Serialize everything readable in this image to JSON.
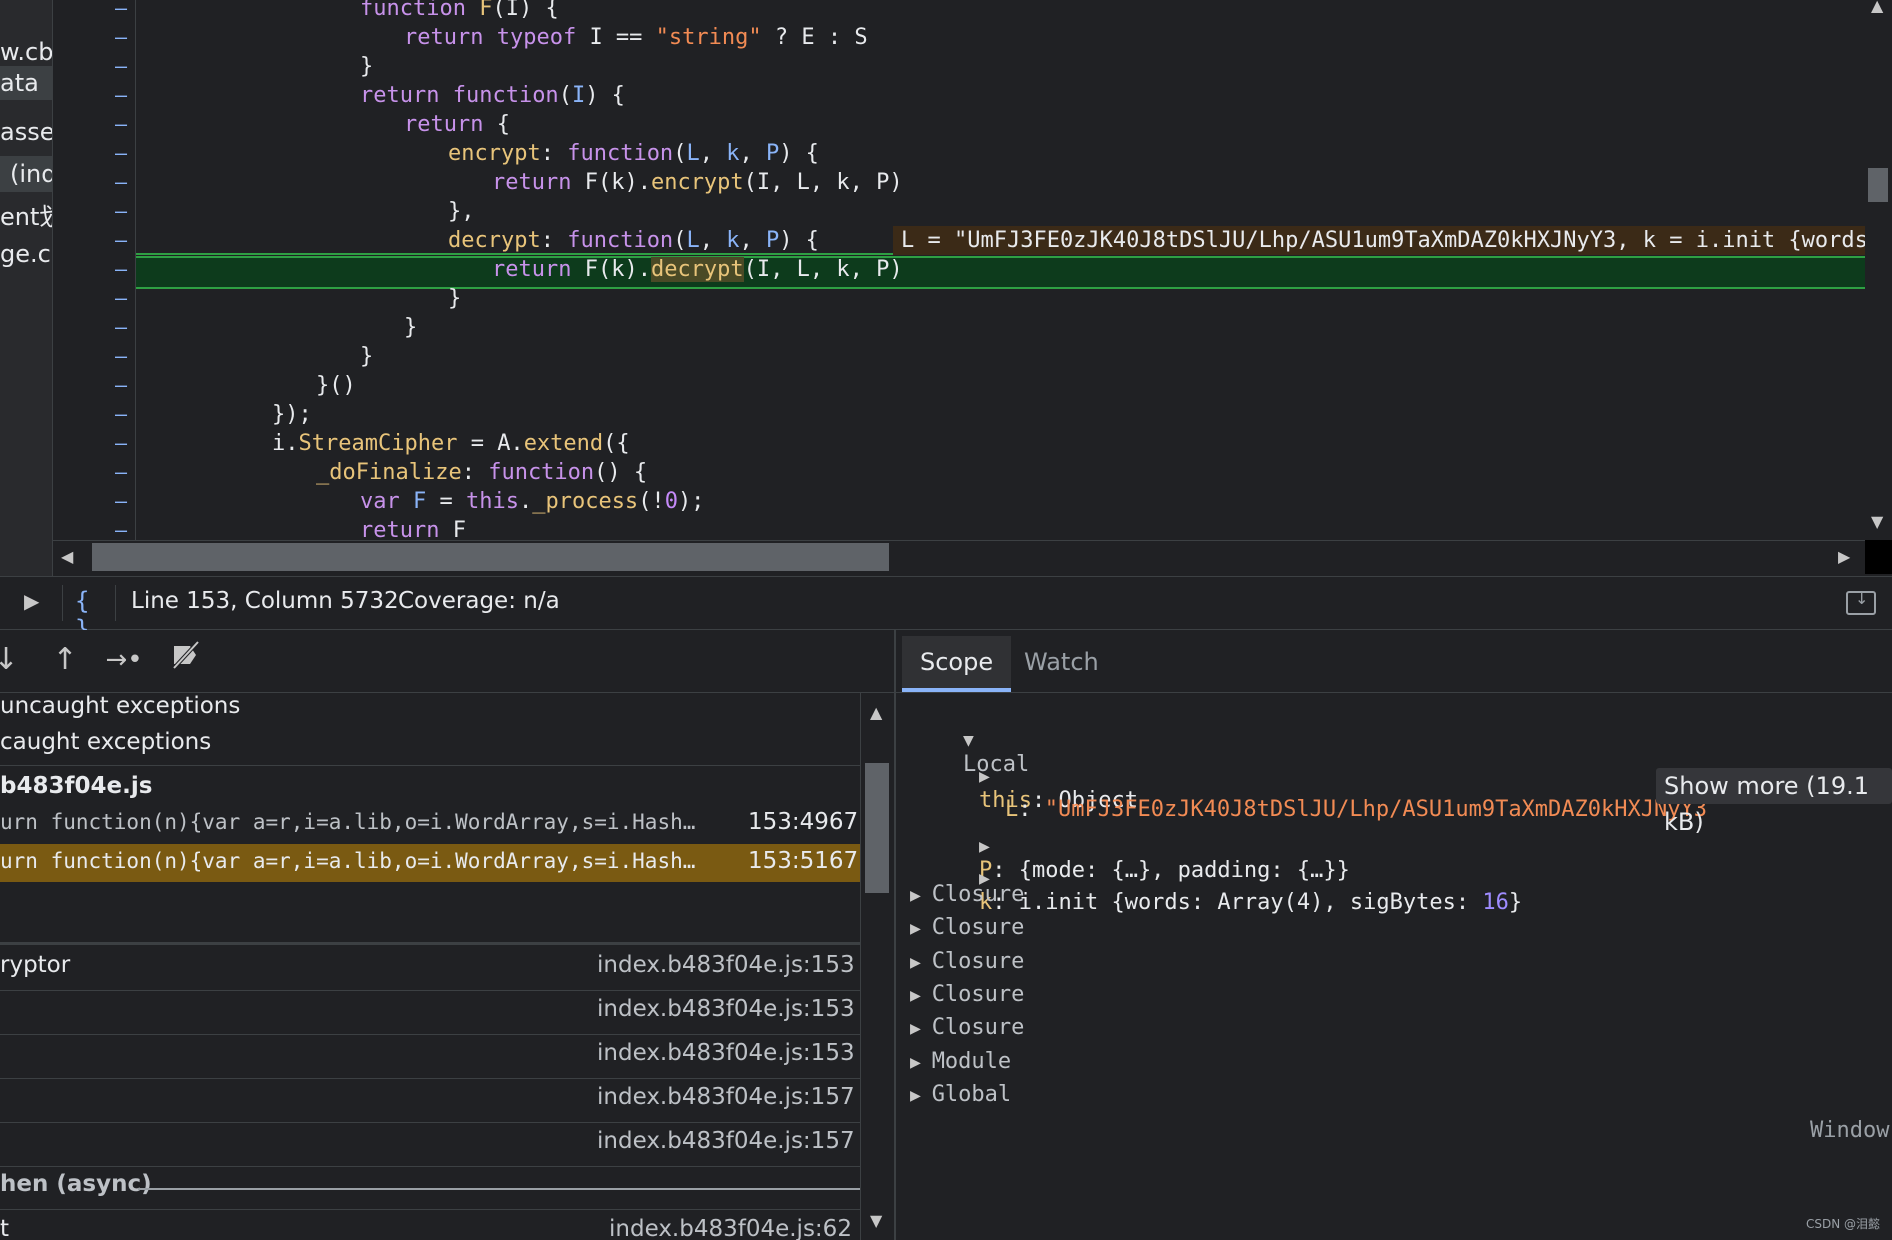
{
  "colors": {
    "background": "#202124",
    "highlight_line": "#0d3b1c",
    "paused_frame": "#7a5a12",
    "accent": "#8ab4f8"
  },
  "navigator": {
    "items": [
      "w.cba",
      "ata",
      "asse",
      "(ind",
      "ent划",
      "ge.cb"
    ]
  },
  "editor": {
    "lines": [
      {
        "indent": 10,
        "tokens": [
          {
            "t": "function ",
            "c": "kw"
          },
          {
            "t": "F",
            "c": "fn"
          },
          {
            "t": "(I) {",
            "c": ""
          }
        ]
      },
      {
        "indent": 12,
        "tokens": [
          {
            "t": "return ",
            "c": "kw"
          },
          {
            "t": "typeof ",
            "c": "kw"
          },
          {
            "t": "I == ",
            "c": ""
          },
          {
            "t": "\"string\"",
            "c": "str"
          },
          {
            "t": " ? E : S",
            "c": ""
          }
        ]
      },
      {
        "indent": 10,
        "tokens": [
          {
            "t": "}",
            "c": ""
          }
        ]
      },
      {
        "indent": 10,
        "tokens": [
          {
            "t": "return ",
            "c": "kw"
          },
          {
            "t": "function",
            "c": "kw"
          },
          {
            "t": "(",
            "c": ""
          },
          {
            "t": "I",
            "c": "param"
          },
          {
            "t": ") {",
            "c": ""
          }
        ]
      },
      {
        "indent": 12,
        "tokens": [
          {
            "t": "return ",
            "c": "kw"
          },
          {
            "t": "{",
            "c": ""
          }
        ]
      },
      {
        "indent": 14,
        "tokens": [
          {
            "t": "encrypt",
            "c": "prop"
          },
          {
            "t": ": ",
            "c": ""
          },
          {
            "t": "function",
            "c": "kw"
          },
          {
            "t": "(",
            "c": ""
          },
          {
            "t": "L",
            "c": "param"
          },
          {
            "t": ", ",
            "c": ""
          },
          {
            "t": "k",
            "c": "param"
          },
          {
            "t": ", ",
            "c": ""
          },
          {
            "t": "P",
            "c": "param"
          },
          {
            "t": ") {",
            "c": ""
          }
        ]
      },
      {
        "indent": 16,
        "tokens": [
          {
            "t": "return ",
            "c": "kw"
          },
          {
            "t": "F(k).",
            "c": ""
          },
          {
            "t": "encrypt",
            "c": "prop"
          },
          {
            "t": "(I, L, k, P)",
            "c": ""
          }
        ]
      },
      {
        "indent": 14,
        "tokens": [
          {
            "t": "},",
            "c": ""
          }
        ]
      },
      {
        "indent": 14,
        "tokens": [
          {
            "t": "decrypt",
            "c": "prop"
          },
          {
            "t": ": ",
            "c": ""
          },
          {
            "t": "function",
            "c": "kw"
          },
          {
            "t": "(",
            "c": ""
          },
          {
            "t": "L",
            "c": "param"
          },
          {
            "t": ", ",
            "c": ""
          },
          {
            "t": "k",
            "c": "param"
          },
          {
            "t": ", ",
            "c": ""
          },
          {
            "t": "P",
            "c": "param"
          },
          {
            "t": ") {",
            "c": ""
          }
        ]
      },
      {
        "indent": 16,
        "tokens": [
          {
            "t": "return ",
            "c": "kw"
          },
          {
            "t": "F(k).",
            "c": ""
          },
          {
            "t": "decrypt",
            "c": "hl"
          },
          {
            "t": "(I, L, k, P)",
            "c": ""
          }
        ]
      },
      {
        "indent": 14,
        "tokens": [
          {
            "t": "}",
            "c": ""
          }
        ]
      },
      {
        "indent": 12,
        "tokens": [
          {
            "t": "}",
            "c": ""
          }
        ]
      },
      {
        "indent": 10,
        "tokens": [
          {
            "t": "}",
            "c": ""
          }
        ]
      },
      {
        "indent": 8,
        "tokens": [
          {
            "t": "}()",
            "c": ""
          }
        ]
      },
      {
        "indent": 6,
        "tokens": [
          {
            "t": "});",
            "c": ""
          }
        ]
      },
      {
        "indent": 6,
        "tokens": [
          {
            "t": "i.",
            "c": ""
          },
          {
            "t": "StreamCipher",
            "c": "prop"
          },
          {
            "t": " = A.",
            "c": ""
          },
          {
            "t": "extend",
            "c": "prop"
          },
          {
            "t": "({",
            "c": ""
          }
        ]
      },
      {
        "indent": 8,
        "tokens": [
          {
            "t": "_doFinalize",
            "c": "prop"
          },
          {
            "t": ": ",
            "c": ""
          },
          {
            "t": "function",
            "c": "kw"
          },
          {
            "t": "() {",
            "c": ""
          }
        ]
      },
      {
        "indent": 10,
        "tokens": [
          {
            "t": "var ",
            "c": "kw"
          },
          {
            "t": "F",
            "c": "param"
          },
          {
            "t": " = ",
            "c": ""
          },
          {
            "t": "this",
            "c": "kw"
          },
          {
            "t": ".",
            "c": ""
          },
          {
            "t": "_process",
            "c": "prop"
          },
          {
            "t": "(!",
            "c": ""
          },
          {
            "t": "0",
            "c": "num"
          },
          {
            "t": ");",
            "c": ""
          }
        ]
      },
      {
        "indent": 10,
        "tokens": [
          {
            "t": "return ",
            "c": "kw"
          },
          {
            "t": "F",
            "c": ""
          }
        ]
      }
    ],
    "inline_value": "L = \"UmFJ3FE0zJK40J8tDSlJU/Lhp/ASU1um9TaXmDAZ0kHXJNyY3, k = i.init {words"
  },
  "status": {
    "position": "Line 153, Column 5732",
    "coverage": "Coverage: n/a"
  },
  "breakpoints": {
    "uncaught": "uncaught exceptions",
    "caught": "caught exceptions",
    "file": "b483f04e.js",
    "entries": [
      {
        "code": "urn function(n){var a=r,i=a.lib,o=i.WordArray,s=i.Hash…",
        "loc": "153:4967"
      },
      {
        "code": "urn function(n){var a=r,i=a.lib,o=i.WordArray,s=i.Hash…",
        "loc": "153:5167"
      }
    ]
  },
  "call_stack": {
    "frames": [
      {
        "name": "ryptor",
        "loc": "index.b483f04e.js:153"
      },
      {
        "name": "",
        "loc": "index.b483f04e.js:153"
      },
      {
        "name": "",
        "loc": "index.b483f04e.js:153"
      },
      {
        "name": "",
        "loc": "index.b483f04e.js:157"
      },
      {
        "name": "",
        "loc": "index.b483f04e.js:157"
      }
    ],
    "async_label": "hen (async)",
    "last_frame": {
      "name": "t",
      "loc": "index.b483f04e.js:62"
    }
  },
  "scope": {
    "tabs": [
      "Scope",
      "Watch"
    ],
    "local_label": "Local",
    "this_key": "this",
    "this_val": "Object",
    "L_key": "L",
    "L_val": "\"UmFJ3FE0zJK40J8tDSlJU/Lhp/ASU1um9TaXmDAZ0kHXJNyY3",
    "show_more": "Show more (19.1 kB)",
    "P_key": "P",
    "P_val": "{mode: {…}, padding: {…}}",
    "k_key": "k",
    "k_val_prefix": "i.init {words: Array(4), sigBytes: ",
    "k_val_num": "16",
    "k_val_suffix": "}",
    "groups": [
      "Closure",
      "Closure",
      "Closure",
      "Closure",
      "Closure",
      "Module",
      "Global"
    ],
    "global_value": "Window"
  },
  "watermark": "CSDN @泪懿"
}
